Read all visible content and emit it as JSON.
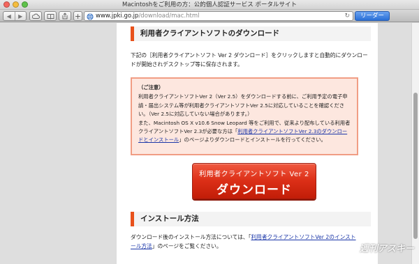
{
  "window": {
    "title": "Macintoshをご利用の方：公的個人認証サービス ポータルサイト"
  },
  "toolbar": {
    "back_icon": "◀",
    "forward_icon": "▶",
    "address": {
      "host": "www.jpki.go.jp",
      "path": "/download/mac.html"
    },
    "reader_label": "リーダー"
  },
  "main": {
    "section1_title": "利用者クライアントソフトのダウンロード",
    "intro_text": "下記の［利用者クライアントソフト Ver 2 ダウンロード］をクリックしますと自動的にダウンロードが開始されデスクトップ等に保存されます。",
    "notice": {
      "title": "（ご注意）",
      "paragraph1": "利用者クライアントソフトVer 2（Ver 2.5）をダウンロードする前に、ご利用予定の電子申請・届出システム等が利用者クライアントソフトVer 2.5に対応していることを確認ください。（Ver 2.5に対応していない場合があります。）",
      "paragraph2_prefix": "また、Macintosh OS X v10.6 Snow Leopard 等をご利用で、従来より配布している利用者クライアントソフトVer 2.3が必要な方は「",
      "paragraph2_link": "利用者クライアントソフトVer 2.3のダウンロードとインストール",
      "paragraph2_suffix": "」のページよりダウンロードとインストールを行ってください。"
    },
    "download_button": {
      "line1": "利用者クライアントソフト Ver 2",
      "line2": "ダウンロード"
    },
    "section2_title": "インストール方法",
    "install_text_prefix": "ダウンロード後のインストール方法については、「",
    "install_link": "利用者クライアントソフトVer 2のインストール方法",
    "install_text_suffix": "」のページをご覧ください。"
  },
  "watermark": "週刊アスキー"
}
